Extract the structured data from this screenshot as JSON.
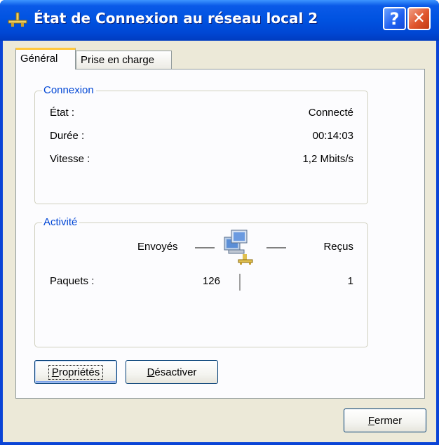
{
  "window": {
    "title": "État de Connexion au réseau local 2",
    "help_label": "?",
    "close_label": "✕"
  },
  "tabs": [
    {
      "label": "Général"
    },
    {
      "label": "Prise en charge"
    }
  ],
  "connexion": {
    "legend": "Connexion",
    "etat_label": "État :",
    "etat_value": "Connecté",
    "duree_label": "Durée :",
    "duree_value": "00:14:03",
    "vitesse_label": "Vitesse :",
    "vitesse_value": "1,2 Mbits/s"
  },
  "activite": {
    "legend": "Activité",
    "envoyes_label": "Envoyés",
    "recus_label": "Reçus",
    "paquets_label": "Paquets :",
    "paquets_envoyes": "126",
    "paquets_recus": "1"
  },
  "buttons": {
    "proprietes_first": "P",
    "proprietes_rest": "ropriétés",
    "desactiver_first": "D",
    "desactiver_rest": "ésactiver",
    "fermer_first": "F",
    "fermer_rest": "ermer"
  },
  "colors": {
    "titlebar": "#0052e0",
    "legend_text": "#0046d5",
    "dialog_bg": "#ece9d8"
  }
}
